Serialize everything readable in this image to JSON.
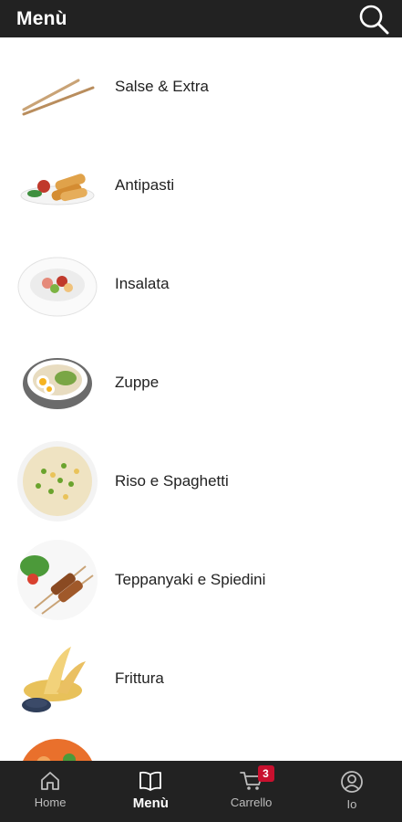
{
  "header": {
    "title": "Menù",
    "search_icon": "search-icon"
  },
  "categories": [
    {
      "label": "Salse & Extra",
      "icon": "chopsticks"
    },
    {
      "label": "Antipasti",
      "icon": "spring-rolls"
    },
    {
      "label": "Insalata",
      "icon": "salad-bowl"
    },
    {
      "label": "Zuppe",
      "icon": "soup-bowl"
    },
    {
      "label": "Riso e Spaghetti",
      "icon": "fried-rice"
    },
    {
      "label": "Teppanyaki e Spiedini",
      "icon": "skewers"
    },
    {
      "label": "Frittura",
      "icon": "tempura"
    },
    {
      "label": "",
      "icon": "partial-dish"
    }
  ],
  "bottom_nav": {
    "home": {
      "label": "Home",
      "icon": "home-icon"
    },
    "menu": {
      "label": "Menù",
      "icon": "book-icon",
      "active": true
    },
    "cart": {
      "label": "Carrello",
      "icon": "cart-icon",
      "badge": "3"
    },
    "profile": {
      "label": "Io",
      "icon": "user-icon"
    }
  },
  "colors": {
    "bar": "#222222",
    "badge": "#c8102e",
    "text": "#222222"
  }
}
